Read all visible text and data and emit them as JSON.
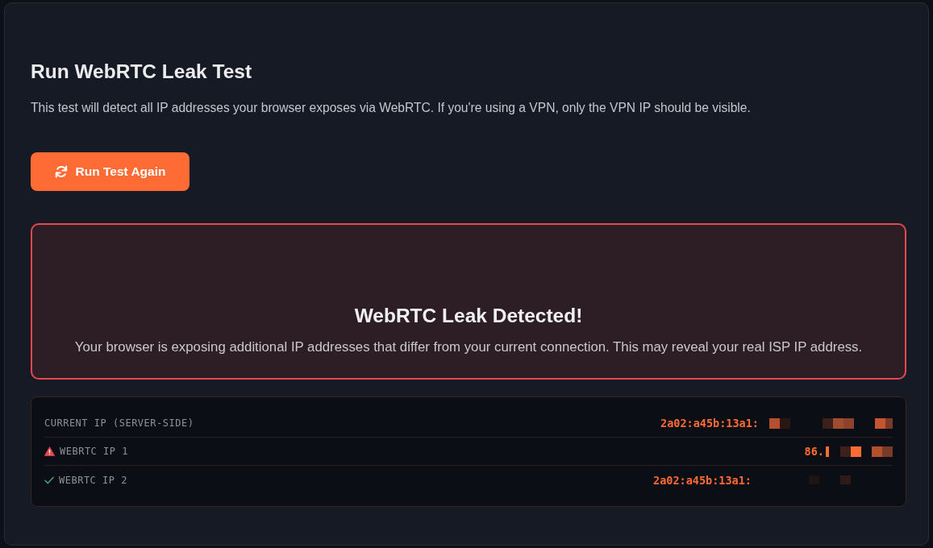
{
  "test": {
    "title": "Run WebRTC Leak Test",
    "description": "This test will detect all IP addresses your browser exposes via WebRTC. If you're using a VPN, only the VPN IP should be visible.",
    "button": {
      "label": "Run Test Again"
    }
  },
  "alert": {
    "title": "WebRTC Leak Detected!",
    "message": "Your browser is exposing additional IP addresses that differ from your current connection. This may reveal your real ISP IP address."
  },
  "results": [
    {
      "kind": "plain",
      "label": "CURRENT IP (SERVER-SIDE)",
      "value": "2a02:a45b:13a1:"
    },
    {
      "kind": "warning",
      "label": "WEBRTC IP 1",
      "value": "86."
    },
    {
      "kind": "ok",
      "label": "WEBRTC IP 2",
      "value": "2a02:a45b:13a1:"
    }
  ]
}
